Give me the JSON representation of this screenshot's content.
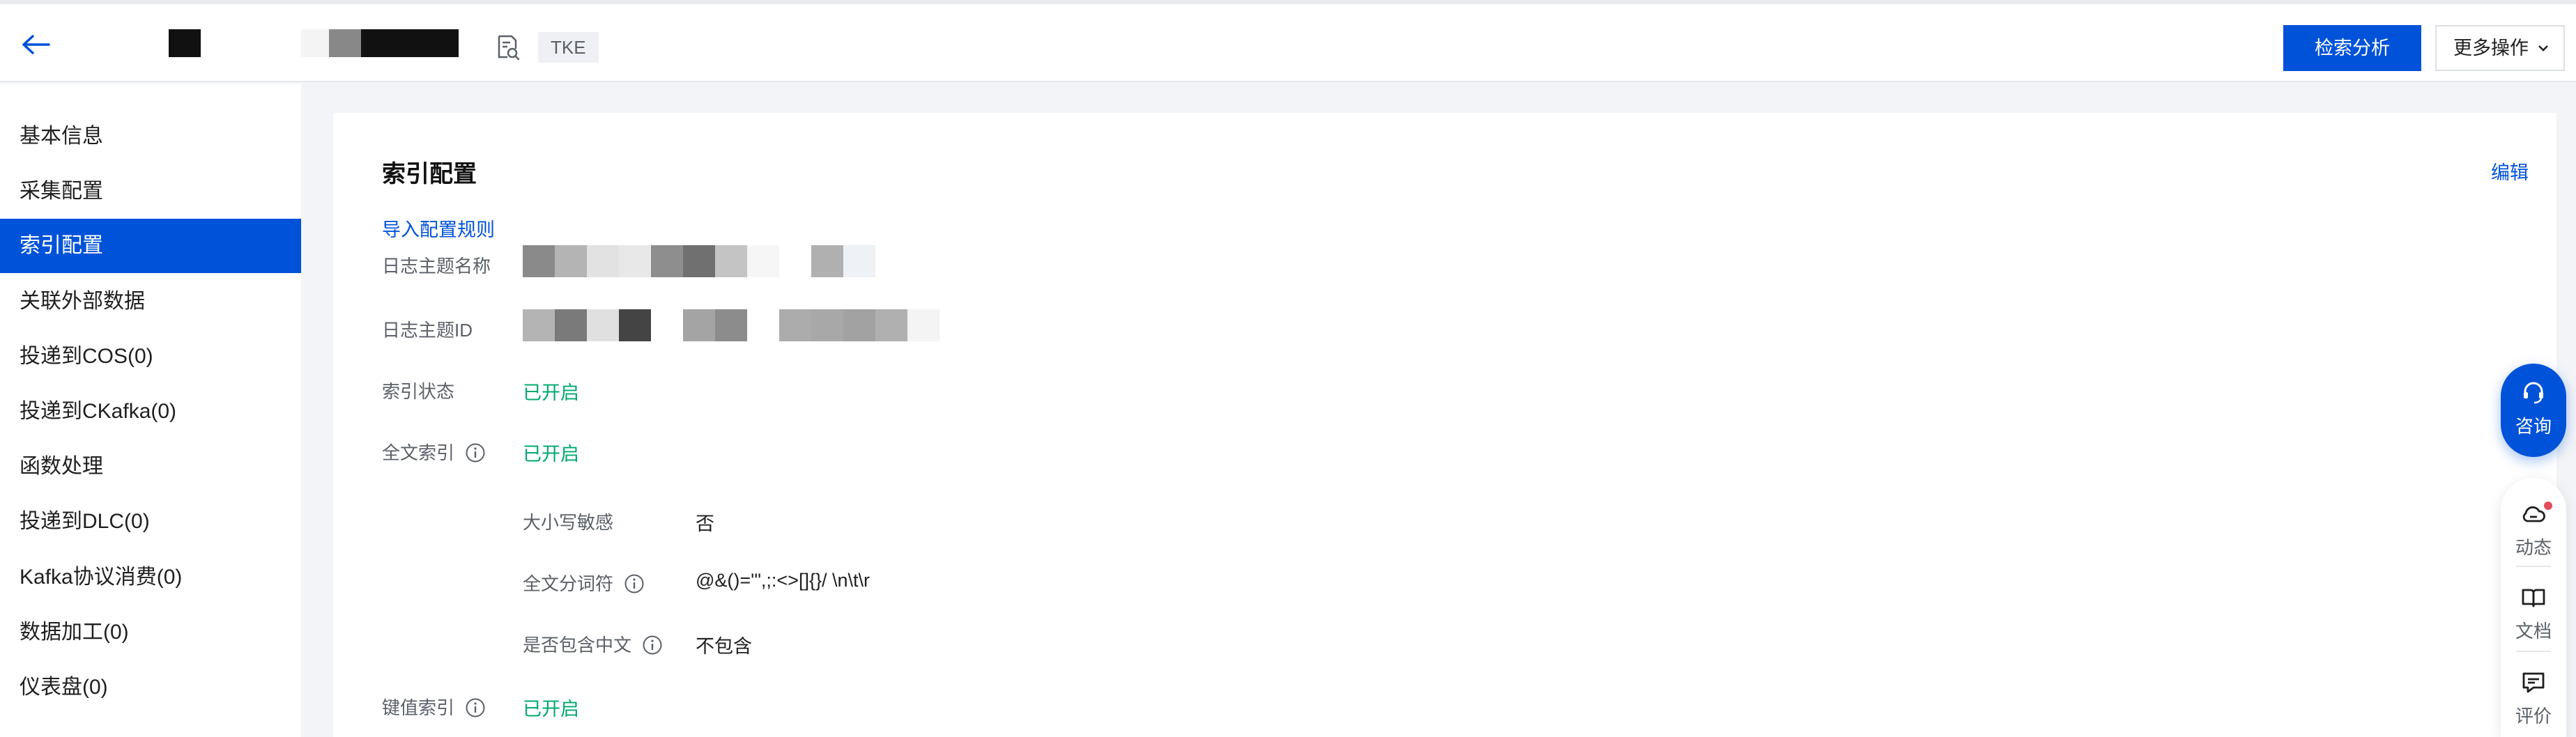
{
  "header": {
    "tag": "TKE",
    "primary_button": "检索分析",
    "more_button": "更多操作"
  },
  "sidebar": {
    "items": [
      {
        "label": "基本信息"
      },
      {
        "label": "采集配置"
      },
      {
        "label": "索引配置"
      },
      {
        "label": "关联外部数据"
      },
      {
        "label": "投递到COS(0)"
      },
      {
        "label": "投递到CKafka(0)"
      },
      {
        "label": "函数处理"
      },
      {
        "label": "投递到DLC(0)"
      },
      {
        "label": "Kafka协议消费(0)"
      },
      {
        "label": "数据加工(0)"
      },
      {
        "label": "仪表盘(0)"
      }
    ],
    "active_index": 2
  },
  "card": {
    "title": "索引配置",
    "edit": "编辑",
    "import_link": "导入配置规则",
    "fields": {
      "topic_name_label": "日志主题名称",
      "topic_id_label": "日志主题ID",
      "index_status_label": "索引状态",
      "index_status_value": "已开启",
      "fulltext_label": "全文索引",
      "fulltext_value": "已开启",
      "case_sensitive_label": "大小写敏感",
      "case_sensitive_value": "否",
      "delimiter_label": "全文分词符",
      "delimiter_value": "@&()='\",;:<>[]{}/ \\n\\t\\r",
      "chinese_label": "是否包含中文",
      "chinese_value": "不包含",
      "kv_label": "键值索引",
      "kv_value": "已开启"
    }
  },
  "helpers": {
    "consult": "咨询",
    "news": "动态",
    "docs": "文档",
    "review": "评价"
  },
  "colors": {
    "primary": "#0052d9",
    "success": "#00a870",
    "badge": "#e34d59"
  }
}
